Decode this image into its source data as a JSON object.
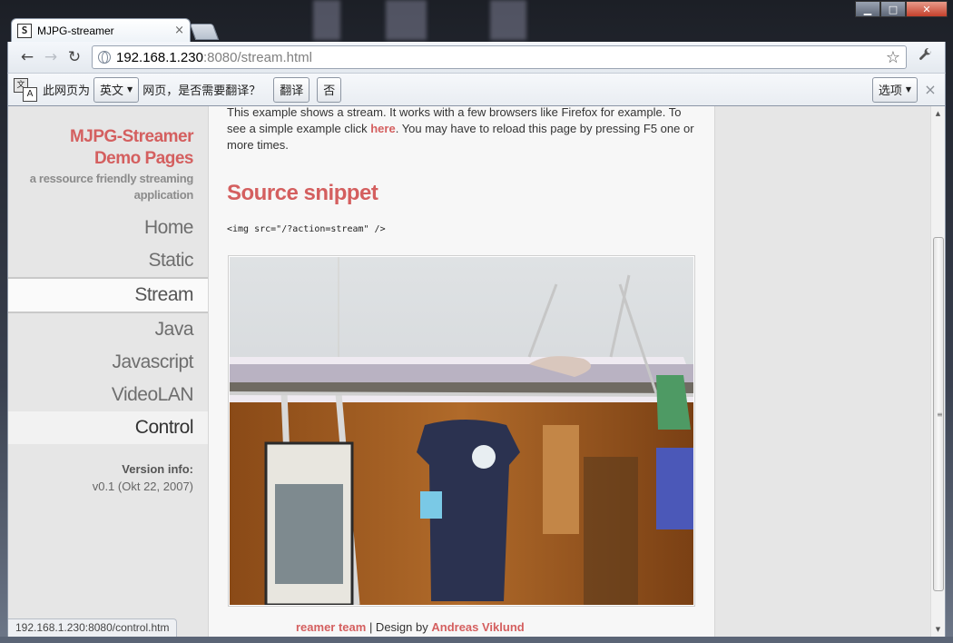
{
  "window": {
    "tab_title": "MJPG-streamer",
    "tab_favicon": "S",
    "tab_close": "×",
    "minimize": "▁",
    "maximize": "□",
    "close": "✕"
  },
  "toolbar": {
    "back": "←",
    "forward": "→",
    "reload": "↻",
    "url_host": "192.168.1.230",
    "url_rest": ":8080/stream.html",
    "star": "☆",
    "wrench": "🔧"
  },
  "translate_bar": {
    "prefix": "此网页为",
    "language": "英文",
    "question": "网页，是否需要翻译？",
    "translate_btn": "翻译",
    "no_btn": "否",
    "options_btn": "选项",
    "close": "×",
    "icon_a": "A",
    "icon_b": "文"
  },
  "sidebar": {
    "brand_line1": "MJPG-Streamer",
    "brand_line2": "Demo Pages",
    "subtitle_line1": "a ressource friendly streaming",
    "subtitle_line2": "application",
    "nav": [
      {
        "label": "Home",
        "state": "normal"
      },
      {
        "label": "Static",
        "state": "normal"
      },
      {
        "label": "Stream",
        "state": "active"
      },
      {
        "label": "Java",
        "state": "normal"
      },
      {
        "label": "Javascript",
        "state": "normal"
      },
      {
        "label": "VideoLAN",
        "state": "normal"
      },
      {
        "label": "Control",
        "state": "hover"
      }
    ],
    "version_label": "Version info:",
    "version_value": "v0.1 (Okt 22, 2007)"
  },
  "content": {
    "intro_before_link": "This example shows a stream. It works with a few browsers like Firefox for example. To see a simple example click ",
    "intro_link": "here",
    "intro_after_link": ". You may have to reload this page by pressing F5 one or more times.",
    "snippet_heading": "Source snippet",
    "code": "<img src=\"/?action=stream\" />",
    "footer_link1": "reamer team",
    "footer_sep": " | Design by ",
    "footer_link2": "Andreas Viklund"
  },
  "status_bar": {
    "url": "192.168.1.230:8080/control.htm"
  },
  "colors": {
    "accent": "#d45f5f",
    "sidebar_bg": "#e6e6e6",
    "content_bg": "#f7f7f7"
  }
}
